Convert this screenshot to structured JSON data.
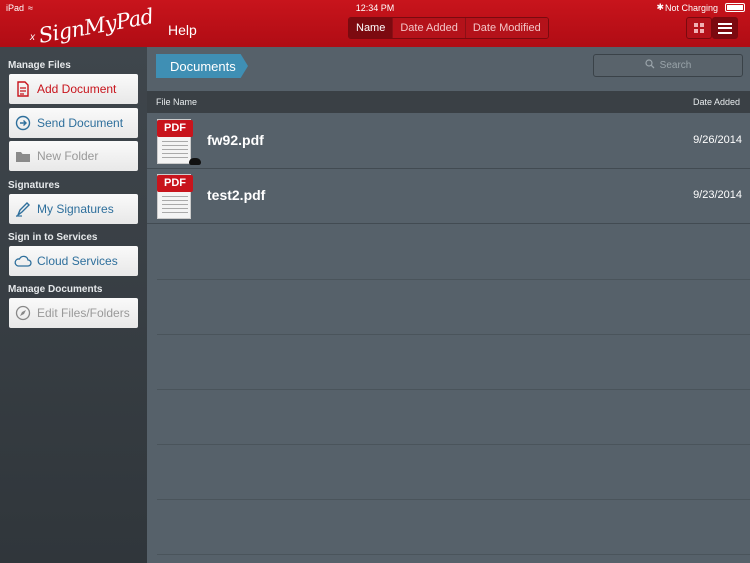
{
  "status": {
    "carrier": "iPad",
    "time": "12:34 PM",
    "battery_text": "Not Charging"
  },
  "header": {
    "logo": "SignMyPad",
    "help": "Help",
    "sort_tabs": [
      "Name",
      "Date Added",
      "Date Modified"
    ],
    "active_sort": "Name"
  },
  "sidebar": {
    "sections": {
      "manage_files": "Manage Files",
      "signatures": "Signatures",
      "sign_in": "Sign in to Services",
      "manage_documents": "Manage Documents"
    },
    "buttons": {
      "add_document": "Add Document",
      "send_document": "Send Document",
      "new_folder": "New Folder",
      "my_signatures": "My Signatures",
      "cloud_services": "Cloud Services",
      "edit_files": "Edit Files/Folders"
    }
  },
  "main": {
    "breadcrumb": "Documents",
    "search_placeholder": "Search",
    "columns": {
      "name": "File Name",
      "date": "Date Added"
    },
    "files": [
      {
        "name": "fw92.pdf",
        "date": "9/26/2014",
        "icon": "PDF"
      },
      {
        "name": "test2.pdf",
        "date": "9/23/2014",
        "icon": "PDF"
      }
    ]
  },
  "colors": {
    "brand_red": "#c8141c",
    "accent_blue": "#3f8fb4"
  }
}
